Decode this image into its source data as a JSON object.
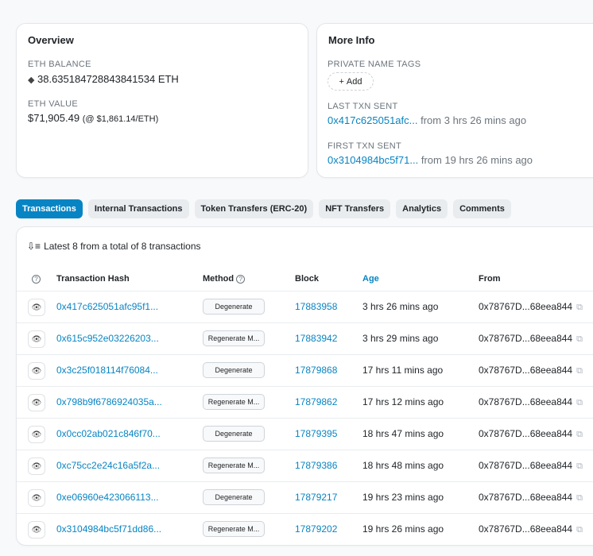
{
  "overview": {
    "title": "Overview",
    "eth_balance_label": "ETH BALANCE",
    "eth_balance_value": "38.635184728843841534 ETH",
    "eth_value_label": "ETH VALUE",
    "eth_value_amount": "$71,905.49",
    "eth_value_rate": "(@ $1,861.14/ETH)"
  },
  "more_info": {
    "title": "More Info",
    "private_tags_label": "PRIVATE NAME TAGS",
    "add_label": "Add",
    "last_txn_label": "LAST TXN SENT",
    "last_txn_hash": "0x417c625051afc...",
    "last_txn_time": "from 3 hrs 26 mins ago",
    "first_txn_label": "FIRST TXN SENT",
    "first_txn_hash": "0x3104984bc5f71...",
    "first_txn_time": "from 19 hrs 26 mins ago"
  },
  "tabs": [
    {
      "label": "Transactions",
      "active": true
    },
    {
      "label": "Internal Transactions",
      "active": false
    },
    {
      "label": "Token Transfers (ERC-20)",
      "active": false
    },
    {
      "label": "NFT Transfers",
      "active": false
    },
    {
      "label": "Analytics",
      "active": false
    },
    {
      "label": "Comments",
      "active": false
    }
  ],
  "transactions": {
    "summary": "Latest 8 from a total of 8 transactions",
    "columns": {
      "hash": "Transaction Hash",
      "method": "Method",
      "block": "Block",
      "age": "Age",
      "from": "From"
    },
    "rows": [
      {
        "hash": "0x417c625051afc95f1...",
        "method": "Degenerate",
        "block": "17883958",
        "age": "3 hrs 26 mins ago",
        "from": "0x78767D...68eea844"
      },
      {
        "hash": "0x615c952e03226203...",
        "method": "Regenerate M...",
        "block": "17883942",
        "age": "3 hrs 29 mins ago",
        "from": "0x78767D...68eea844"
      },
      {
        "hash": "0x3c25f018114f76084...",
        "method": "Degenerate",
        "block": "17879868",
        "age": "17 hrs 11 mins ago",
        "from": "0x78767D...68eea844"
      },
      {
        "hash": "0x798b9f6786924035a...",
        "method": "Regenerate M...",
        "block": "17879862",
        "age": "17 hrs 12 mins ago",
        "from": "0x78767D...68eea844"
      },
      {
        "hash": "0x0cc02ab021c846f70...",
        "method": "Degenerate",
        "block": "17879395",
        "age": "18 hrs 47 mins ago",
        "from": "0x78767D...68eea844"
      },
      {
        "hash": "0xc75cc2e24c16a5f2a...",
        "method": "Regenerate M...",
        "block": "17879386",
        "age": "18 hrs 48 mins ago",
        "from": "0x78767D...68eea844"
      },
      {
        "hash": "0xe06960e423066113...",
        "method": "Degenerate",
        "block": "17879217",
        "age": "19 hrs 23 mins ago",
        "from": "0x78767D...68eea844"
      },
      {
        "hash": "0x3104984bc5f71dd86...",
        "method": "Regenerate M...",
        "block": "17879202",
        "age": "19 hrs 26 mins ago",
        "from": "0x78767D...68eea844"
      }
    ]
  },
  "colors": {
    "link": "#0784c3",
    "active_tab": "#0784c3",
    "muted": "#6c757d"
  },
  "icons": {
    "eth": "ethereum-diamond-icon",
    "eye": "eye-icon",
    "copy": "copy-icon",
    "sort": "sort-icon",
    "question": "question-circle-icon",
    "plus": "plus-icon"
  }
}
